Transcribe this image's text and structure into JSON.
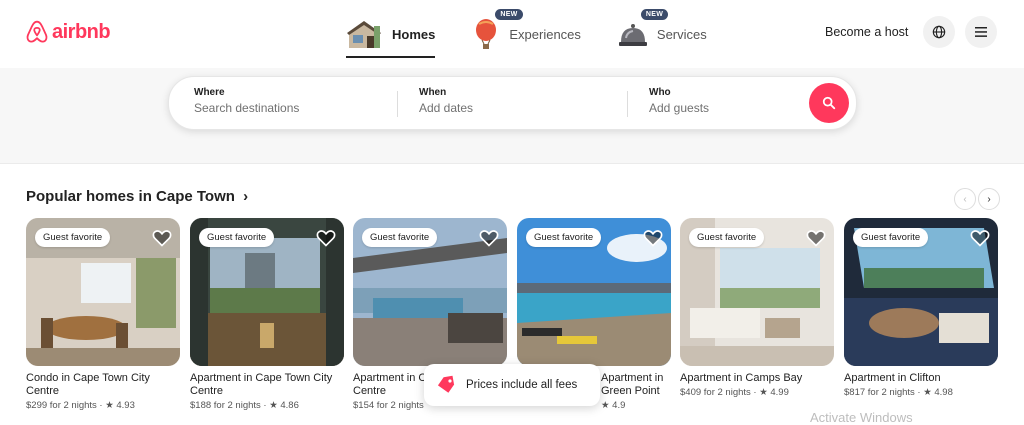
{
  "header": {
    "logo_text": "airbnb",
    "nav": [
      {
        "label": "Homes",
        "icon": "house-icon",
        "active": true
      },
      {
        "label": "Experiences",
        "icon": "balloon-icon",
        "badge": "NEW"
      },
      {
        "label": "Services",
        "icon": "bell-icon",
        "badge": "NEW"
      }
    ],
    "become_host": "Become a host",
    "globe_icon": "globe-icon",
    "menu_icon": "menu-icon"
  },
  "search": {
    "where_label": "Where",
    "where_placeholder": "Search destinations",
    "when_label": "When",
    "when_placeholder": "Add dates",
    "who_label": "Who",
    "who_placeholder": "Add guests",
    "button_icon": "search-icon",
    "accent": "#ff385c"
  },
  "section": {
    "title": "Popular homes in Cape Town",
    "title_arrow": "›",
    "prev_icon": "‹",
    "next_icon": "›"
  },
  "cards": [
    {
      "badge": "Guest favorite",
      "title": "Condo in Cape Town City Centre",
      "sub": "$299 for 2 nights · ★ 4.93"
    },
    {
      "badge": "Guest favorite",
      "title": "Apartment in Cape Town City Centre",
      "sub": "$188 for 2 nights · ★ 4.86"
    },
    {
      "badge": "Guest favorite",
      "title": "Apartment in Cape Town City Centre",
      "sub": "$154 for 2 nights"
    },
    {
      "badge": "Guest favorite",
      "title": "Apartment in Green Point",
      "sub": "★ 4.9"
    },
    {
      "badge": "Guest favorite",
      "title": "Apartment in Camps Bay",
      "sub": "$409 for 2 nights · ★ 4.99"
    },
    {
      "badge": "Guest favorite",
      "title": "Apartment in Clifton",
      "sub": "$817 for 2 nights · ★ 4.98"
    }
  ],
  "toast": {
    "text": "Prices include all fees",
    "icon": "price-tag-icon"
  },
  "watermark": "Activate Windows"
}
